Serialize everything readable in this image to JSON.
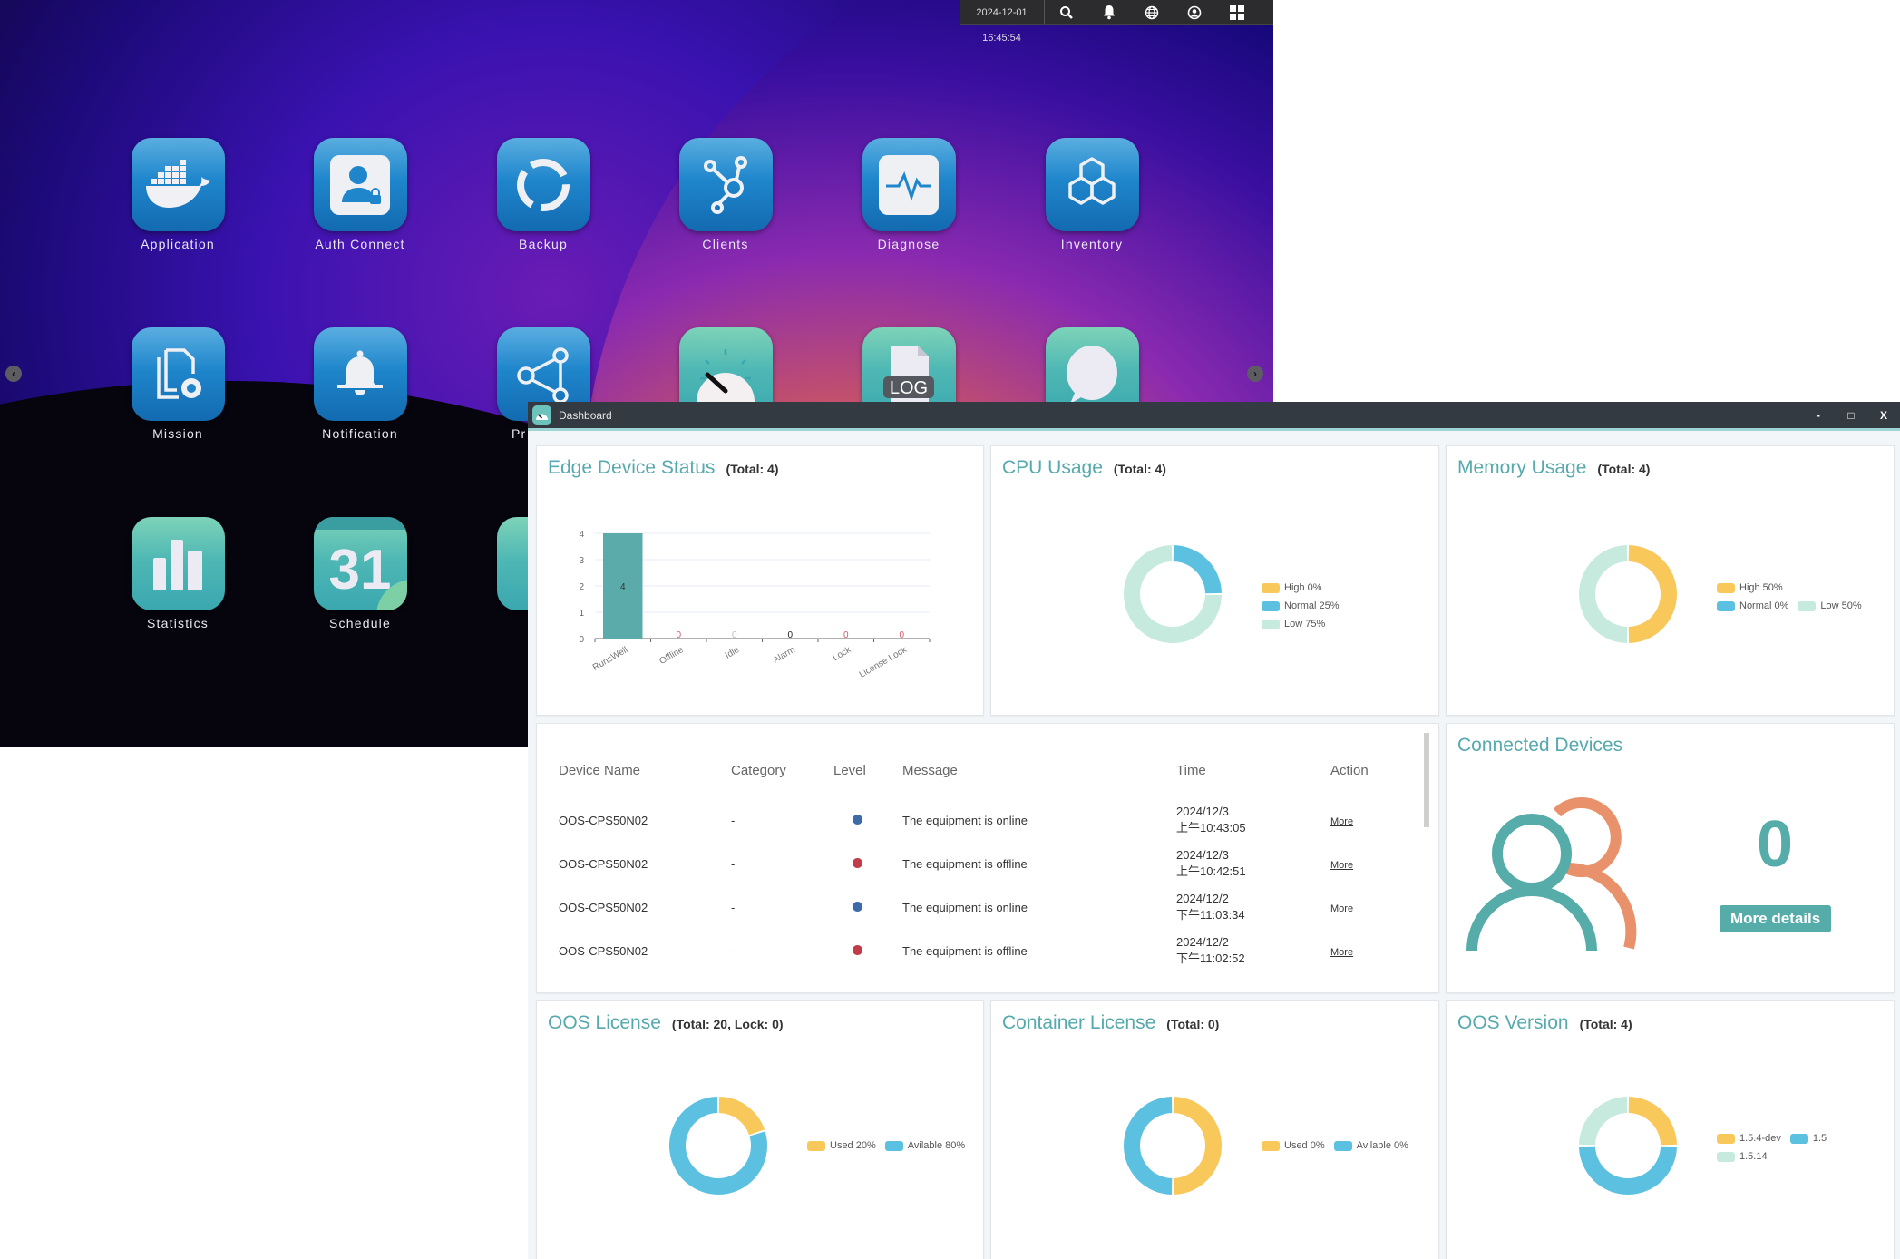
{
  "topbar": {
    "datetime": "2024-12-01 16:45:54",
    "icons": [
      "search-icon",
      "bell-icon",
      "globe-icon",
      "user-circle-icon",
      "apps-grid-icon"
    ]
  },
  "desktop": {
    "apps": [
      {
        "label": "Application",
        "icon": "docker-whale-icon",
        "style": "blue"
      },
      {
        "label": "Auth Connect",
        "icon": "user-lock-icon",
        "style": "blue"
      },
      {
        "label": "Backup",
        "icon": "circular-arrows-icon",
        "style": "blue"
      },
      {
        "label": "Clients",
        "icon": "hub-nodes-icon",
        "style": "blue"
      },
      {
        "label": "Diagnose",
        "icon": "pulse-monitor-icon",
        "style": "blue"
      },
      {
        "label": "Inventory",
        "icon": "cubes-icon",
        "style": "blue"
      },
      {
        "label": "Mission",
        "icon": "document-gear-icon",
        "style": "blue"
      },
      {
        "label": "Notification",
        "icon": "bell-icon",
        "style": "blue"
      },
      {
        "label": "Pr",
        "icon": "share-nodes-icon",
        "style": "blue"
      },
      {
        "label": "",
        "icon": "gauge-icon",
        "style": "teal"
      },
      {
        "label": "",
        "icon": "log-file-icon",
        "style": "teal"
      },
      {
        "label": "",
        "icon": "chat-bubble-icon",
        "style": "teal"
      },
      {
        "label": "Statistics",
        "icon": "bar-chart-icon",
        "style": "teal"
      },
      {
        "label": "Schedule",
        "icon": "calendar-icon",
        "style": "teal",
        "badge": "31"
      },
      {
        "label": "",
        "icon": "app-icon",
        "style": "teal"
      }
    ]
  },
  "window": {
    "title": "Dashboard",
    "controls": {
      "minimize": "-",
      "maximize": "□",
      "close": "X"
    }
  },
  "cards": {
    "edge": {
      "title": "Edge Device Status",
      "subtitle": "(Total: 4)"
    },
    "cpu": {
      "title": "CPU Usage",
      "subtitle": "(Total: 4)"
    },
    "mem": {
      "title": "Memory Usage",
      "subtitle": "(Total: 4)"
    },
    "connected": {
      "title": "Connected Devices",
      "count": "0",
      "button": "More details"
    },
    "oos_license": {
      "title": "OOS License",
      "subtitle": "(Total: 20, Lock: 0)"
    },
    "container_license": {
      "title": "Container License",
      "subtitle": "(Total: 0)"
    },
    "oos_version": {
      "title": "OOS Version",
      "subtitle": "(Total: 4)"
    }
  },
  "events": {
    "columns": [
      "Device Name",
      "Category",
      "Level",
      "Message",
      "Time",
      "Action"
    ],
    "rows": [
      {
        "device": "OOS-CPS50N02",
        "category": "-",
        "level": "online",
        "level_color": "#3d6aa8",
        "message": "The equipment is online",
        "date": "2024/12/3",
        "time": "上午10:43:05",
        "action": "More"
      },
      {
        "device": "OOS-CPS50N02",
        "category": "-",
        "level": "offline",
        "level_color": "#c23b48",
        "message": "The equipment is offline",
        "date": "2024/12/3",
        "time": "上午10:42:51",
        "action": "More"
      },
      {
        "device": "OOS-CPS50N02",
        "category": "-",
        "level": "online",
        "level_color": "#3d6aa8",
        "message": "The equipment is online",
        "date": "2024/12/2",
        "time": "下午11:03:34",
        "action": "More"
      },
      {
        "device": "OOS-CPS50N02",
        "category": "-",
        "level": "offline",
        "level_color": "#c23b48",
        "message": "The equipment is offline",
        "date": "2024/12/2",
        "time": "下午11:02:52",
        "action": "More"
      }
    ]
  },
  "colors": {
    "accent": "#56a9ad",
    "yellow": "#f9c85a",
    "blue": "#5cc1e0",
    "mint": "#c7eadf",
    "bar": "#5aabaa",
    "orange": "#e8916a"
  },
  "chart_data": [
    {
      "id": "edge",
      "type": "bar",
      "title": "Edge Device Status",
      "categories": [
        "RunsWell",
        "Offline",
        "Idle",
        "Alarm",
        "Lock",
        "License Lock"
      ],
      "values": [
        4,
        0,
        0,
        0,
        0,
        0
      ],
      "ylim": [
        0,
        4
      ],
      "yticks": [
        0,
        1,
        2,
        3,
        4
      ],
      "grid": true
    },
    {
      "id": "cpu",
      "type": "pie",
      "title": "CPU Usage",
      "labels": [
        "High 0%",
        "Normal 25%",
        "Low 75%"
      ],
      "values": [
        0,
        25,
        75
      ],
      "colors": [
        "#f9c85a",
        "#5cc1e0",
        "#c7eadf"
      ],
      "legend": "right"
    },
    {
      "id": "mem",
      "type": "pie",
      "title": "Memory Usage",
      "labels": [
        "High 50%",
        "Normal 0%",
        "Low 50%"
      ],
      "values": [
        50,
        0,
        50
      ],
      "colors": [
        "#f9c85a",
        "#5cc1e0",
        "#c7eadf"
      ],
      "legend": "right"
    },
    {
      "id": "oos_license",
      "type": "pie",
      "title": "OOS License",
      "labels": [
        "Used 20%",
        "Avilable 80%"
      ],
      "values": [
        20,
        80
      ],
      "colors": [
        "#f9c85a",
        "#5cc1e0"
      ],
      "legend": "right"
    },
    {
      "id": "container_license",
      "type": "pie",
      "title": "Container License",
      "labels": [
        "Used 0%",
        "Avilable 0%"
      ],
      "values": [
        1,
        1
      ],
      "colors": [
        "#f9c85a",
        "#5cc1e0"
      ],
      "legend": "right"
    },
    {
      "id": "oos_version",
      "type": "pie",
      "title": "OOS Version",
      "labels": [
        "1.5.4-dev",
        "1.5",
        "1.5.14"
      ],
      "values": [
        1,
        2,
        1
      ],
      "colors": [
        "#f9c85a",
        "#5cc1e0",
        "#c7eadf"
      ],
      "legend": "right"
    }
  ]
}
